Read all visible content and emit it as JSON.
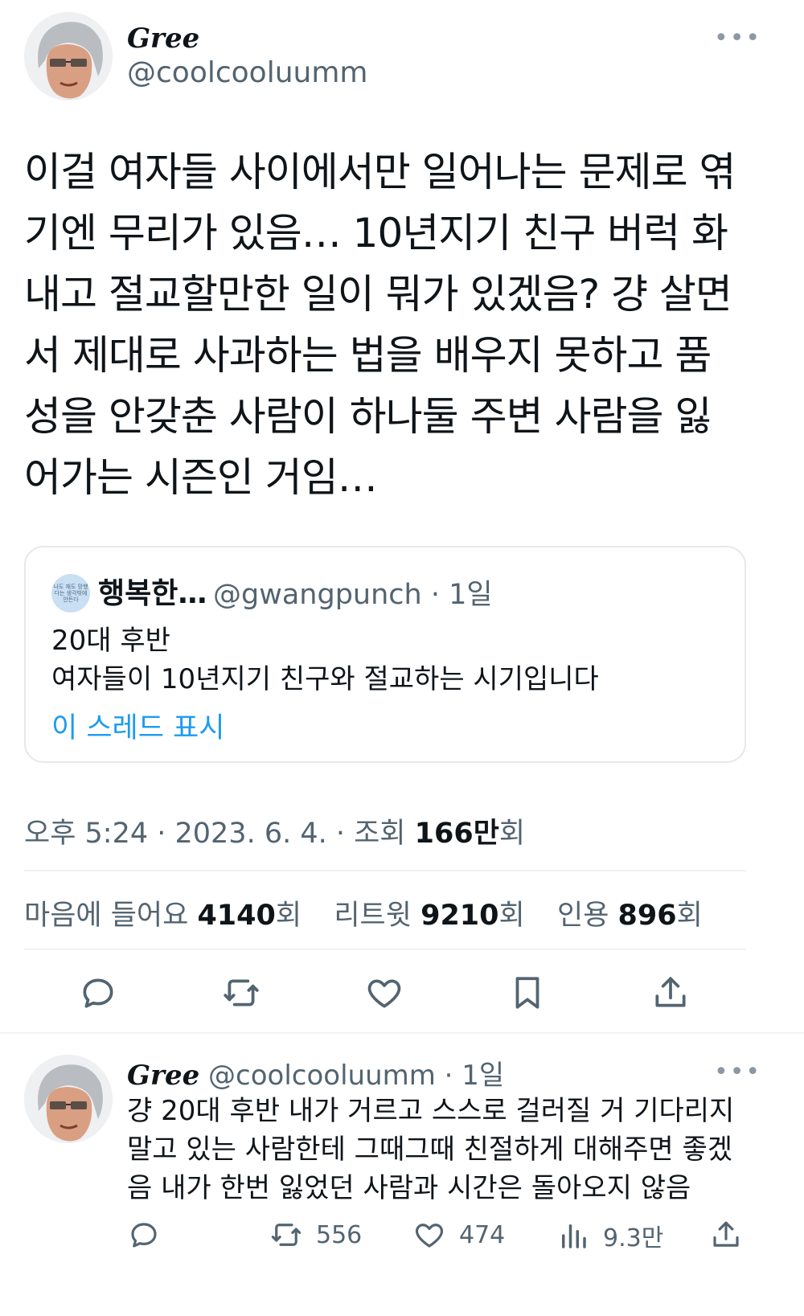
{
  "tweet": {
    "display_name": "Gree",
    "handle": "@coolcooluumm",
    "more_icon": "ellipsis-icon",
    "lines": [
      "이걸 여자들 사이에서만 일어나는 문제로 엮",
      "기엔 무리가 있음… 10년지기 친구 버럭 화",
      "내고 절교할만한 일이 뭐가 있겠음? 걍 살면",
      "서 제대로 사과하는 법을 배우지 못하고 품",
      "성을 안갖춘 사람이 하나둘 주변 사람을 잃",
      "어가는 시즌인 거임…"
    ]
  },
  "quote": {
    "avatar_text": "나도 재도 망했다는 생각밖에 안든다",
    "display_name": "행복한…",
    "handle_time": "@gwangpunch · 1일",
    "line1": "20대 후반",
    "line2": "여자들이 10년지기 친구와 절교하는  시기입니다",
    "show_thread": "이 스레드 표시"
  },
  "meta": {
    "prefix": "오후 5:24 · 2023. 6. 4. · 조회 ",
    "views": "166만",
    "views_suffix": "회"
  },
  "stats": {
    "likes_label": "마음에 들어요 ",
    "likes": "4140",
    "likes_suffix": "회",
    "retweets_label": "리트윗 ",
    "retweets": "9210",
    "retweets_suffix": "회",
    "quotes_label": "인용 ",
    "quotes": "896",
    "quotes_suffix": "회"
  },
  "actions": [
    "reply-icon",
    "retweet-icon",
    "like-icon",
    "bookmark-icon",
    "share-icon"
  ],
  "reply": {
    "display_name": "Gree",
    "handle_time": "@coolcooluumm · 1일",
    "lines": [
      "걍 20대 후반 내가 거르고 스스로 걸러질 거 기다리지",
      "말고 있는 사람한테 그때그때 친절하게 대해주면 좋겠",
      "음 내가 한번 잃었던 사람과 시간은 돌아오지 않음"
    ],
    "retweets": "556",
    "likes": "474",
    "views": "9.3만"
  },
  "colors": {
    "accent": "#1d9bf0",
    "muted": "#536471",
    "text": "#0f1419",
    "divider": "#eff3f4"
  }
}
